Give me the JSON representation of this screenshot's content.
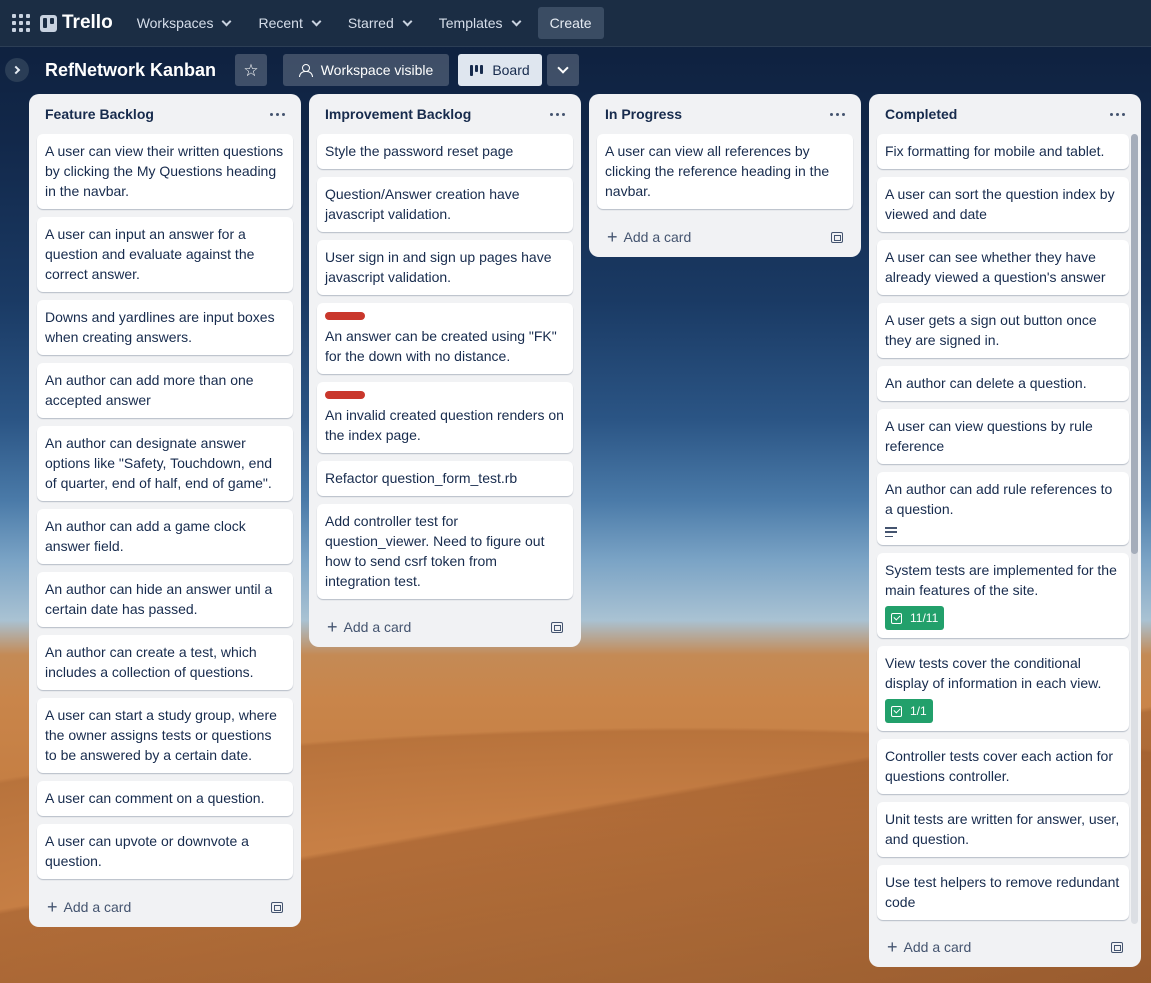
{
  "app": {
    "name": "Trello"
  },
  "nav": {
    "workspaces": "Workspaces",
    "recent": "Recent",
    "starred": "Starred",
    "templates": "Templates",
    "create": "Create"
  },
  "board": {
    "title": "RefNetwork Kanban",
    "visibility": "Workspace visible",
    "view": "Board"
  },
  "add_card_label": "Add a card",
  "lists": [
    {
      "title": "Feature Backlog",
      "cards": [
        {
          "text": "A user can view their written questions by clicking the My Questions heading in the navbar."
        },
        {
          "text": "A user can input an answer for a question and evaluate against the correct answer."
        },
        {
          "text": "Downs and yardlines are input boxes when creating answers."
        },
        {
          "text": "An author can add more than one accepted answer"
        },
        {
          "text": "An author can designate answer options like \"Safety, Touchdown, end of quarter, end of half, end of game\"."
        },
        {
          "text": "An author can add a game clock answer field."
        },
        {
          "text": "An author can hide an answer until a certain date has passed."
        },
        {
          "text": "An author can create a test, which includes a collection of questions."
        },
        {
          "text": "A user can start a study group, where the owner assigns tests or questions to be answered by a certain date."
        },
        {
          "text": "A user can comment on a question."
        },
        {
          "text": "A user can upvote or downvote a question."
        }
      ]
    },
    {
      "title": "Improvement Backlog",
      "cards": [
        {
          "text": "Style the password reset page"
        },
        {
          "text": "Question/Answer creation have javascript validation."
        },
        {
          "text": "User sign in and sign up pages have javascript validation."
        },
        {
          "text": "An answer can be created using \"FK\" for the down with no distance.",
          "label_color": "#c9372c"
        },
        {
          "text": "An invalid created question renders on the index page.",
          "label_color": "#c9372c"
        },
        {
          "text": "Refactor question_form_test.rb"
        },
        {
          "text": "Add controller test for question_viewer. Need to figure out how to send csrf token from integration test."
        }
      ]
    },
    {
      "title": "In Progress",
      "cards": [
        {
          "text": "A user can view all references by clicking the reference heading in the navbar."
        }
      ]
    },
    {
      "title": "Completed",
      "cards": [
        {
          "text": "Fix formatting for mobile and tablet."
        },
        {
          "text": "A user can sort the question index by viewed and date"
        },
        {
          "text": "A user can see whether they have already viewed a question's answer"
        },
        {
          "text": "A user gets a sign out button once they are signed in."
        },
        {
          "text": "An author can delete a question."
        },
        {
          "text": "A user can view questions by rule reference"
        },
        {
          "text": "An author can add rule references to a question.",
          "has_description": true
        },
        {
          "text": "System tests are implemented for the main features of the site.",
          "checklist": "11/11"
        },
        {
          "text": "View tests cover the conditional display of information in each view.",
          "checklist": "1/1"
        },
        {
          "text": "Controller tests cover each action for questions controller."
        },
        {
          "text": "Unit tests are written for answer, user, and question."
        },
        {
          "text": "Use test helpers to remove redundant code"
        }
      ]
    }
  ],
  "colors": {
    "label_red": "#c9372c",
    "checklist_green": "#22a06b",
    "topbar": "#1b2d44"
  }
}
